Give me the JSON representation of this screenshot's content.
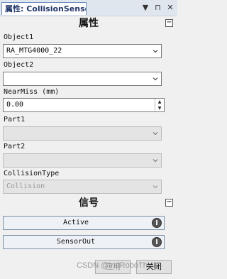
{
  "window": {
    "tab_title": "属性: CollisionSensor",
    "title_icons": [
      "pin-icon",
      "close-icon"
    ]
  },
  "properties": {
    "section_title": "属性",
    "object1": {
      "label": "Object1",
      "value": "RA_MTG4000_22"
    },
    "object2": {
      "label": "Object2",
      "value": ""
    },
    "near_miss": {
      "label": "NearMiss (mm)",
      "value": "0.00"
    },
    "part1": {
      "label": "Part1",
      "value": ""
    },
    "part2": {
      "label": "Part2",
      "value": ""
    },
    "collision_type": {
      "label": "CollisionType",
      "value": "Collision"
    }
  },
  "signals": {
    "section_title": "信号",
    "items": [
      {
        "name": "Active",
        "state": "0"
      },
      {
        "name": "SensorOut",
        "state": "0"
      }
    ]
  },
  "footer": {
    "apply_label": "应用",
    "close_label": "关闭",
    "watermark": "CSDN @IndRoboThink"
  }
}
